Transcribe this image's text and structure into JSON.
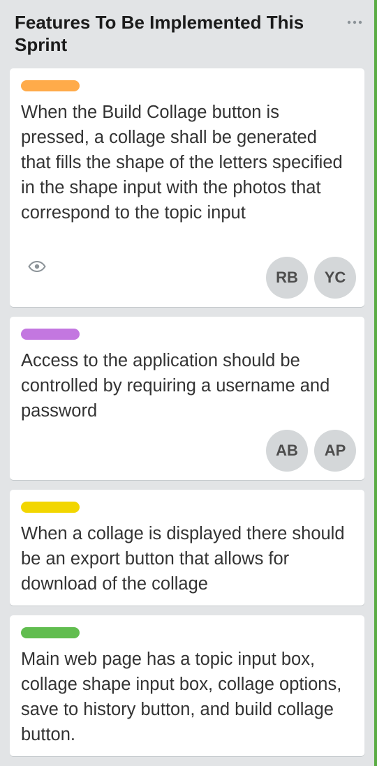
{
  "list": {
    "title": "Features To Be Implemented This Sprint",
    "menu_icon": "more-horizontal-icon"
  },
  "cards": [
    {
      "label_color": "#ffab4a",
      "text": "When the Build Collage button is pressed, a collage shall be generated that fills the shape of the letters specified in the shape input with the photos that correspond to the topic input",
      "badges": [
        "eye-icon"
      ],
      "members": [
        "RB",
        "YC"
      ]
    },
    {
      "label_color": "#c377e0",
      "text": "Access to the application should be controlled by requiring a username and password",
      "badges": [],
      "members": [
        "AB",
        "AP"
      ]
    },
    {
      "label_color": "#f2d600",
      "text": "When a collage is displayed there should be an export button that allows for download of the collage",
      "badges": [],
      "members": []
    },
    {
      "label_color": "#61bd4f",
      "text": "Main web page has a topic input box, collage shape input box, collage options, save to history button, and build collage button.",
      "badges": [],
      "members": []
    }
  ]
}
